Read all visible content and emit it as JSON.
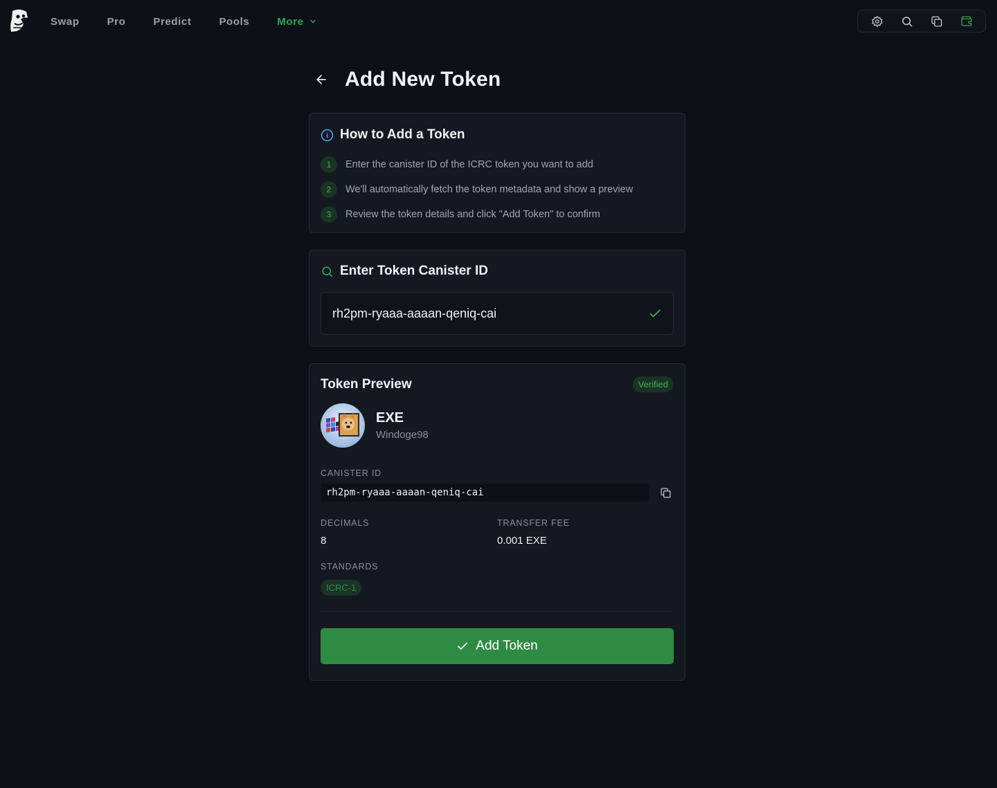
{
  "nav": {
    "links": [
      {
        "label": "Swap"
      },
      {
        "label": "Pro"
      },
      {
        "label": "Predict"
      },
      {
        "label": "Pools"
      },
      {
        "label": "More"
      }
    ],
    "active_color": "#33a853",
    "icons": [
      "settings-icon",
      "search-icon",
      "copy-icon",
      "wallet-icon"
    ]
  },
  "page": {
    "title": "Add New Token"
  },
  "howto": {
    "title": "How to Add a Token",
    "steps": [
      {
        "num": "1",
        "text": "Enter the canister ID of the ICRC token you want to add"
      },
      {
        "num": "2",
        "text": "We'll automatically fetch the token metadata and show a preview"
      },
      {
        "num": "3",
        "text": "Review the token details and click \"Add Token\" to confirm"
      }
    ]
  },
  "canister_input": {
    "title": "Enter Token Canister ID",
    "value": "rh2pm-ryaaa-aaaan-qeniq-cai"
  },
  "preview": {
    "title": "Token Preview",
    "badge": "Verified",
    "symbol": "EXE",
    "name": "Windoge98",
    "canister_label": "CANISTER ID",
    "canister_id": "rh2pm-ryaaa-aaaan-qeniq-cai",
    "decimals_label": "DECIMALS",
    "decimals": "8",
    "fee_label": "TRANSFER FEE",
    "fee": "0.001 EXE",
    "standards_label": "STANDARDS",
    "standards": [
      "ICRC-1"
    ],
    "add_button": "Add Token"
  },
  "colors": {
    "background": "#0d1017",
    "card": "#141820",
    "accent": "#2f8a43",
    "info_blue": "#4da3ff"
  }
}
